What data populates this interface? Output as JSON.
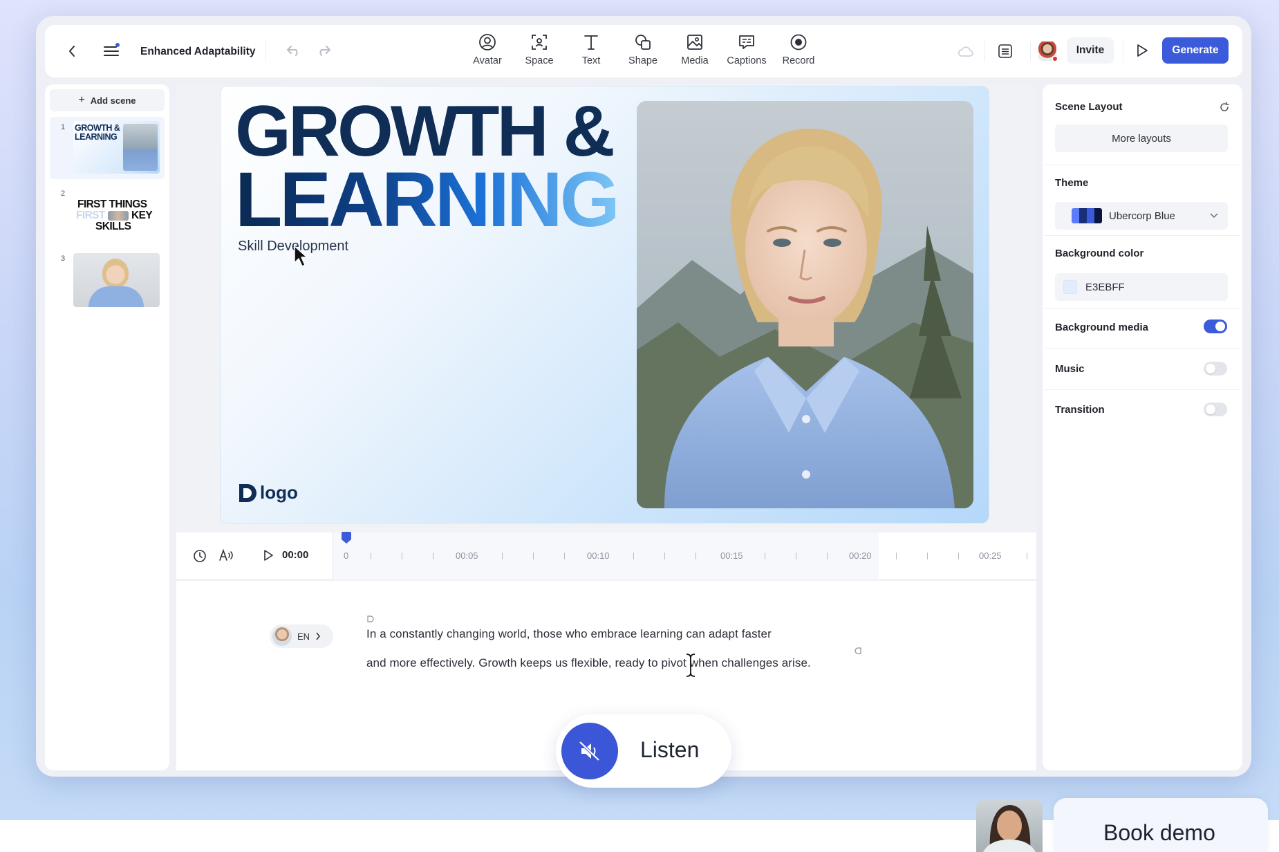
{
  "header": {
    "project_title": "Enhanced Adaptability",
    "tools": [
      {
        "label": "Avatar",
        "icon": "avatar-icon"
      },
      {
        "label": "Space",
        "icon": "space-icon"
      },
      {
        "label": "Text",
        "icon": "text-icon"
      },
      {
        "label": "Shape",
        "icon": "shape-icon"
      },
      {
        "label": "Media",
        "icon": "media-icon"
      },
      {
        "label": "Captions",
        "icon": "captions-icon"
      },
      {
        "label": "Record",
        "icon": "record-icon"
      }
    ],
    "invite_label": "Invite",
    "generate_label": "Generate"
  },
  "scenes": {
    "add_label": "Add scene",
    "items": [
      {
        "number": "1",
        "thumb_text": "GROWTH & LEARNING"
      },
      {
        "number": "2",
        "thumb_line1": "FIRST THINGS",
        "thumb_line2a": "FIRST",
        "thumb_line2b": "KEY",
        "thumb_line3": "SKILLS"
      },
      {
        "number": "3"
      }
    ]
  },
  "canvas": {
    "headline_line1": "GROWTH &",
    "headline_line2": "LEARNING",
    "subtitle": "Skill Development",
    "logo_text": "logo"
  },
  "timeline": {
    "current_time": "00:00",
    "labels": [
      "0",
      "00:05",
      "00:10",
      "00:15",
      "00:20",
      "00:25"
    ]
  },
  "script": {
    "language": "EN",
    "line1": "In a constantly changing world, those who embrace learning can adapt faster",
    "line2": "and more effectively. Growth keeps us flexible, ready to pivot when challenges arise."
  },
  "listen": {
    "label": "Listen"
  },
  "properties": {
    "scene_layout_label": "Scene Layout",
    "more_layouts_label": "More layouts",
    "theme_label": "Theme",
    "theme_value": "Ubercorp Blue",
    "bg_color_label": "Background color",
    "bg_color_value": "E3EBFF",
    "bg_media_label": "Background media",
    "bg_media_on": true,
    "music_label": "Music",
    "music_on": false,
    "transition_label": "Transition",
    "transition_on": false
  },
  "colors": {
    "accent": "#3b5bdb",
    "bg_color_swatch": "#E3EBFF"
  },
  "cta": {
    "book_demo_label": "Book demo"
  }
}
